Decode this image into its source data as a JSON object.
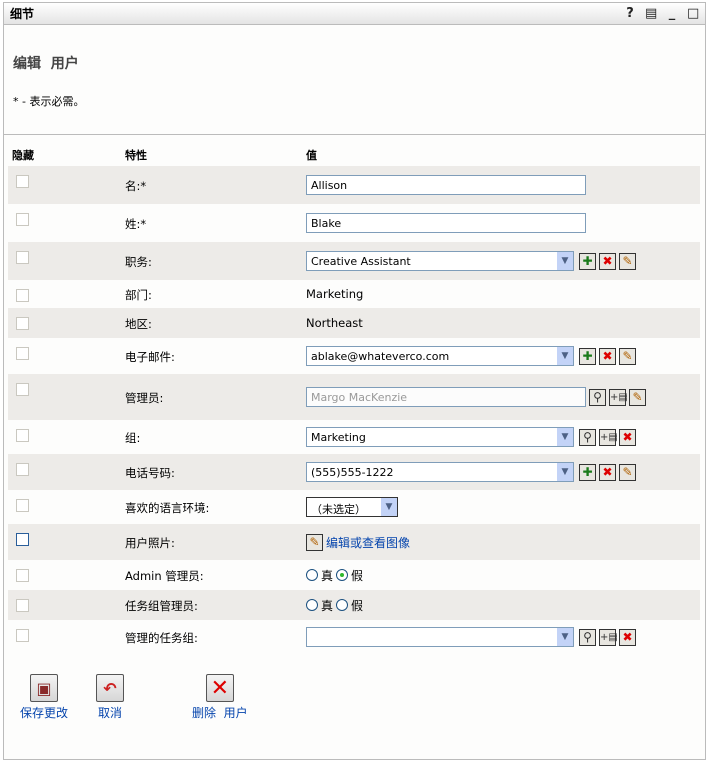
{
  "window": {
    "title": "细节",
    "icons": [
      "help-icon",
      "print-icon",
      "minimize-icon",
      "maximize-icon"
    ]
  },
  "header": {
    "title": "编辑  用户",
    "required_note": "* - 表示必需。"
  },
  "columns": {
    "hide": "隐藏",
    "attribute": "特性",
    "value": "值"
  },
  "rows": [
    {
      "label": "名:*",
      "type": "input",
      "value": "Allison",
      "h": 38
    },
    {
      "label": "姓:*",
      "type": "input",
      "value": "Blake",
      "h": 38
    },
    {
      "label": "职务:",
      "type": "select",
      "value": "Creative Assistant",
      "buttons": [
        "plus",
        "x",
        "pen"
      ],
      "h": 38
    },
    {
      "label": "部门:",
      "type": "text",
      "value": "Marketing",
      "h": 28
    },
    {
      "label": "地区:",
      "type": "text",
      "value": "Northeast",
      "h": 30
    },
    {
      "label": "电子邮件:",
      "type": "select",
      "value": "ablake@whateverco.com",
      "buttons": [
        "plus",
        "x",
        "pen"
      ],
      "h": 36
    },
    {
      "label": "管理员:",
      "type": "disabled",
      "value": "Margo MacKenzie",
      "buttons": [
        "search",
        "add",
        "pen"
      ],
      "h": 46
    },
    {
      "label": "组:",
      "type": "select",
      "value": "Marketing",
      "buttons": [
        "search",
        "add",
        "x"
      ],
      "h": 34
    },
    {
      "label": "电话号码:",
      "type": "select",
      "value": "(555)555-1222",
      "buttons": [
        "plus",
        "x",
        "pen"
      ],
      "h": 36
    },
    {
      "label": "喜欢的语言环境:",
      "type": "small-select",
      "value": "（未选定）",
      "h": 34
    },
    {
      "label": "用户照片:",
      "type": "link",
      "value": "编辑或查看图像",
      "h": 36,
      "blue": true
    },
    {
      "label": "Admin 管理员:",
      "type": "radio",
      "true_label": "真",
      "false_label": "假",
      "selected": "false",
      "h": 30
    },
    {
      "label": "任务组管理员:",
      "type": "radio",
      "true_label": "真",
      "false_label": "假",
      "selected": "none",
      "h": 30
    },
    {
      "label": "管理的任务组:",
      "type": "select",
      "value": "",
      "buttons": [
        "search",
        "add",
        "x"
      ],
      "h": 34
    }
  ],
  "actions": {
    "save": "保存更改",
    "cancel": "取消",
    "delete": "删除  用户"
  }
}
